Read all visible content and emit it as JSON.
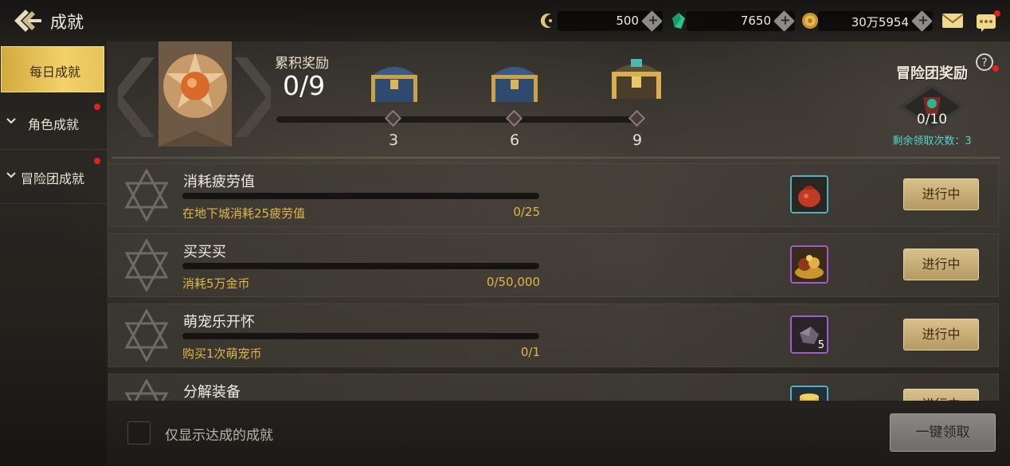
{
  "header": {
    "title": "成就",
    "currencies": [
      {
        "icon": "crescent-currency-icon",
        "value": "500"
      },
      {
        "icon": "green-gem-icon",
        "value": "7650"
      },
      {
        "icon": "gold-coin-icon",
        "value": "30万5954"
      }
    ]
  },
  "sidebar": {
    "items": [
      {
        "label": "每日成就",
        "active": true,
        "has_dot": false
      },
      {
        "label": "角色成就",
        "active": false,
        "has_dot": true
      },
      {
        "label": "冒险团成就",
        "active": false,
        "has_dot": true
      }
    ]
  },
  "cumulative": {
    "title": "累积奖励",
    "count": "0/9",
    "progress": 0,
    "milestones": [
      "3",
      "6",
      "9"
    ]
  },
  "adventure": {
    "title": "冒险团奖励",
    "count": "0/10",
    "remaining": "剩余领取次数：3"
  },
  "achievements": [
    {
      "name": "消耗疲劳值",
      "desc": "在地下城消耗25疲劳值",
      "progress": "0/25",
      "fill": 0,
      "reward_icon": "red-pouch-icon",
      "reward_qty": "",
      "status": "进行中"
    },
    {
      "name": "买买买",
      "desc": "消耗5万金币",
      "progress": "0/50,000",
      "fill": 0,
      "reward_icon": "treasure-pile-icon",
      "reward_qty": "",
      "status": "进行中"
    },
    {
      "name": "萌宠乐开怀",
      "desc": "购买1次萌宠币",
      "progress": "0/1",
      "fill": 0,
      "reward_icon": "crystal-ore-icon",
      "reward_qty": "5",
      "status": "进行中"
    },
    {
      "name": "分解装备",
      "desc": "",
      "progress": "",
      "fill": 0,
      "reward_icon": "gold-stack-icon",
      "reward_qty": "",
      "status": "进行中"
    }
  ],
  "footer": {
    "filter_label": "仅显示达成的成就",
    "claim_all_label": "一键领取"
  }
}
